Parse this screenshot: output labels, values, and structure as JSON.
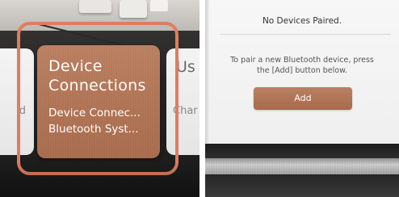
{
  "left_photo": {
    "focused_card": {
      "title": "Device Connections",
      "subtitle_line1": "Device Connec...",
      "subtitle_line2": "Bluetooth Syst..."
    },
    "left_partial_card": {
      "text": "d"
    },
    "right_partial_card": {
      "title_fragment": "Us",
      "sub_fragment": "Char"
    },
    "highlight_color": "#e07c5e",
    "card_color": "#b07454"
  },
  "right_photo": {
    "header": "No Devices Paired.",
    "instruction_line1": "To pair a new Bluetooth device, press",
    "instruction_line2": "the [Add] button below.",
    "add_button_label": "Add",
    "button_color": "#b07454"
  }
}
